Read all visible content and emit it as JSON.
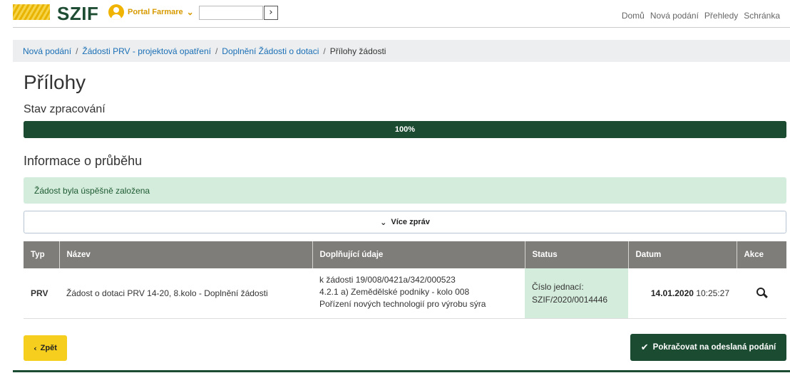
{
  "header": {
    "logo_text": "SZIF",
    "portal_label": "Portal Farmare",
    "search_placeholder": "",
    "nav": [
      "Domů",
      "Nová podání",
      "Přehledy",
      "Schránka"
    ]
  },
  "breadcrumb": {
    "items": [
      "Nová podání",
      "Žádosti PRV - projektová opatření",
      "Doplnění Žádosti o dotaci"
    ],
    "current": "Přílohy žádosti"
  },
  "page": {
    "title": "Přílohy",
    "progress_heading": "Stav zpracování",
    "progress_value": 1.0,
    "progress_label": "100%",
    "info_heading": "Informace o průběhu",
    "alert_text": "Žádost byla úspěšně založena",
    "more_label": "Více zpráv"
  },
  "table": {
    "columns": [
      "Typ",
      "Název",
      "Doplňující údaje",
      "Status",
      "Datum",
      "Akce"
    ],
    "rows": [
      {
        "typ": "PRV",
        "nazev": "Žádost o dotaci PRV 14-20, 8.kolo - Doplnění žádosti",
        "doplnujici": [
          "k žádosti 19/008/0421a/342/000523",
          "4.2.1 a) Zemědělské podniky - kolo 008",
          "Pořízení nových technologií pro výrobu sýra"
        ],
        "status": [
          "Číslo jednací:",
          "SZIF/2020/0014446"
        ],
        "datum_date": "14.01.2020",
        "datum_time": "10:25:27"
      }
    ]
  },
  "actions": {
    "back_label": "Zpět",
    "continue_label": "Pokračovat na odeslaná podání"
  },
  "colors": {
    "brand_green": "#1b4b31",
    "accent_yellow": "#f6cf1e",
    "success_bg": "#d4ecdb",
    "header_gray": "#7f7d79"
  },
  "icons": [
    "user-icon",
    "chevron-down-icon",
    "chevron-right-icon",
    "search-icon",
    "chevron-left-icon",
    "check-icon"
  ]
}
